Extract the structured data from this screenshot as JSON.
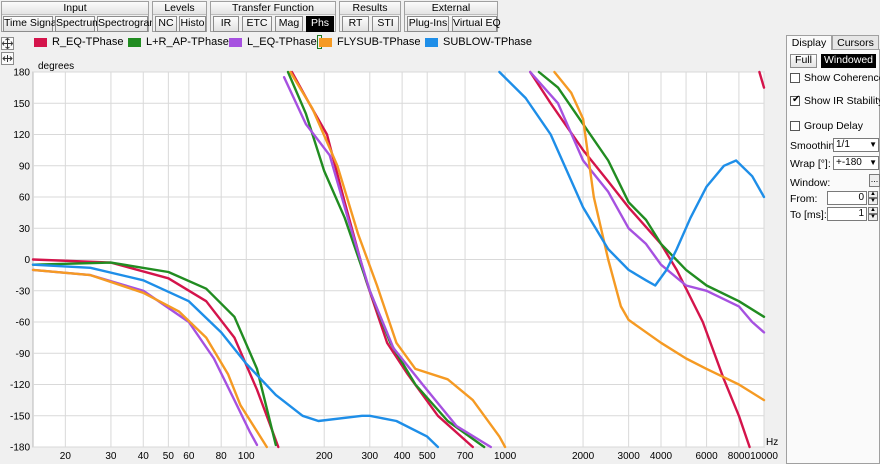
{
  "toolbar": {
    "groups": [
      {
        "title": "Input",
        "buttons": [
          "Time Signal",
          "Spectrum",
          "Spectrogram"
        ]
      },
      {
        "title": "Levels",
        "buttons": [
          "NC",
          "Histo"
        ]
      },
      {
        "title": "Transfer Function",
        "buttons": [
          "IR",
          "ETC",
          "Mag",
          "Phs"
        ]
      },
      {
        "title": "Results",
        "buttons": [
          "RT",
          "STI"
        ]
      },
      {
        "title": "External",
        "buttons": [
          "Plug-Ins",
          "Virtual EQ"
        ]
      }
    ],
    "active_button": "Phs"
  },
  "chart_data": {
    "type": "line",
    "ylabel": "degrees",
    "xlabel": "Hz",
    "x_scale": "log",
    "xlim": [
      15,
      10000
    ],
    "ylim": [
      -180,
      180
    ],
    "x_ticks": [
      20,
      30,
      40,
      50,
      60,
      80,
      100,
      200,
      300,
      400,
      500,
      700,
      1000,
      2000,
      3000,
      4000,
      5000,
      6000,
      8000,
      10000
    ],
    "x_tick_labels": [
      "20",
      "30",
      "40",
      "50",
      "60",
      "80",
      "100",
      "200",
      "300",
      "400",
      "500",
      "700",
      "1000",
      "2000",
      "3000",
      "4000",
      "6000",
      "8000",
      "10000"
    ],
    "y_ticks": [
      180,
      150,
      120,
      90,
      60,
      30,
      0,
      -30,
      -60,
      -90,
      -120,
      -150,
      -180
    ],
    "grid": true,
    "legend_position": "top",
    "series": [
      {
        "name": "R_EQ-TPhase",
        "color": "#d4144b",
        "segments": [
          [
            [
              15,
              0
            ],
            [
              30,
              -3
            ],
            [
              50,
              -18
            ],
            [
              70,
              -40
            ],
            [
              90,
              -75
            ],
            [
              110,
              -125
            ],
            [
              125,
              -162
            ],
            [
              133,
              -180
            ]
          ],
          [
            [
              150,
              180
            ],
            [
              175,
              150
            ],
            [
              205,
              120
            ],
            [
              240,
              55
            ],
            [
              290,
              -20
            ],
            [
              350,
              -80
            ],
            [
              420,
              -110
            ],
            [
              550,
              -150
            ],
            [
              750,
              -180
            ]
          ],
          [
            [
              1250,
              180
            ],
            [
              1500,
              150
            ],
            [
              2000,
              105
            ],
            [
              2500,
              75
            ],
            [
              3000,
              50
            ],
            [
              4000,
              15
            ],
            [
              4600,
              -10
            ],
            [
              5800,
              -60
            ],
            [
              7000,
              -115
            ],
            [
              8000,
              -150
            ],
            [
              8800,
              -180
            ]
          ],
          [
            [
              9600,
              180
            ],
            [
              10000,
              165
            ]
          ]
        ]
      },
      {
        "name": "L+R_AP-TPhase",
        "color": "#218c21",
        "segments": [
          [
            [
              15,
              -5
            ],
            [
              30,
              -3
            ],
            [
              50,
              -12
            ],
            [
              70,
              -28
            ],
            [
              90,
              -55
            ],
            [
              110,
              -105
            ],
            [
              122,
              -150
            ],
            [
              130,
              -178
            ]
          ],
          [
            [
              145,
              180
            ],
            [
              170,
              140
            ],
            [
              200,
              85
            ],
            [
              240,
              40
            ],
            [
              300,
              -30
            ],
            [
              360,
              -80
            ],
            [
              450,
              -120
            ],
            [
              600,
              -155
            ],
            [
              830,
              -180
            ]
          ],
          [
            [
              1350,
              180
            ],
            [
              1600,
              165
            ],
            [
              2000,
              130
            ],
            [
              2500,
              95
            ],
            [
              3000,
              55
            ],
            [
              3500,
              38
            ],
            [
              4000,
              15
            ],
            [
              5000,
              -10
            ],
            [
              6000,
              -25
            ],
            [
              8000,
              -40
            ],
            [
              10000,
              -55
            ]
          ]
        ]
      },
      {
        "name": "L_EQ-TPhase",
        "color": "#a651e0",
        "segments": [
          [
            [
              15,
              -10
            ],
            [
              25,
              -15
            ],
            [
              40,
              -30
            ],
            [
              60,
              -60
            ],
            [
              75,
              -95
            ],
            [
              90,
              -135
            ],
            [
              103,
              -165
            ],
            [
              110,
              -178
            ]
          ],
          [
            [
              140,
              175
            ],
            [
              170,
              130
            ],
            [
              210,
              100
            ],
            [
              250,
              35
            ],
            [
              300,
              -30
            ],
            [
              370,
              -85
            ],
            [
              480,
              -120
            ],
            [
              650,
              -160
            ],
            [
              880,
              -180
            ]
          ],
          [
            [
              1250,
              180
            ],
            [
              1600,
              150
            ],
            [
              2000,
              95
            ],
            [
              2500,
              65
            ],
            [
              3000,
              30
            ],
            [
              3500,
              15
            ],
            [
              4000,
              -5
            ],
            [
              5000,
              -25
            ],
            [
              6000,
              -30
            ],
            [
              8000,
              -45
            ],
            [
              9000,
              -60
            ],
            [
              10000,
              -70
            ]
          ]
        ]
      },
      {
        "name": "FLYSUB-TPhase",
        "color": "#f59a23",
        "segments": [
          [
            [
              15,
              -10
            ],
            [
              25,
              -15
            ],
            [
              40,
              -32
            ],
            [
              55,
              -50
            ],
            [
              70,
              -75
            ],
            [
              85,
              -110
            ],
            [
              95,
              -140
            ],
            [
              110,
              -165
            ],
            [
              120,
              -180
            ]
          ],
          [
            [
              148,
              180
            ],
            [
              180,
              145
            ],
            [
              225,
              90
            ],
            [
              270,
              25
            ],
            [
              320,
              -25
            ],
            [
              380,
              -80
            ],
            [
              450,
              -105
            ],
            [
              600,
              -115
            ],
            [
              750,
              -135
            ],
            [
              950,
              -170
            ],
            [
              1000,
              -180
            ]
          ],
          [
            [
              1550,
              180
            ],
            [
              1800,
              160
            ],
            [
              2000,
              135
            ],
            [
              2200,
              60
            ],
            [
              2500,
              0
            ],
            [
              2800,
              -45
            ],
            [
              3000,
              -58
            ],
            [
              4000,
              -80
            ],
            [
              5000,
              -95
            ],
            [
              6000,
              -105
            ],
            [
              8000,
              -120
            ],
            [
              10000,
              -135
            ]
          ]
        ]
      },
      {
        "name": "SUBLOW-TPhase",
        "color": "#1e8ee8",
        "segments": [
          [
            [
              15,
              -5
            ],
            [
              25,
              -8
            ],
            [
              40,
              -20
            ],
            [
              60,
              -40
            ],
            [
              80,
              -70
            ],
            [
              100,
              -100
            ],
            [
              130,
              -130
            ],
            [
              165,
              -150
            ],
            [
              190,
              -155
            ],
            [
              280,
              -150
            ],
            [
              300,
              -150
            ],
            [
              380,
              -155
            ],
            [
              500,
              -170
            ],
            [
              550,
              -180
            ]
          ],
          [
            [
              950,
              180
            ],
            [
              1200,
              155
            ],
            [
              1500,
              120
            ],
            [
              2000,
              50
            ],
            [
              2500,
              10
            ],
            [
              3000,
              -10
            ],
            [
              3500,
              -20
            ],
            [
              3800,
              -25
            ],
            [
              4200,
              -10
            ],
            [
              4600,
              10
            ],
            [
              5200,
              40
            ],
            [
              6000,
              70
            ],
            [
              7000,
              90
            ],
            [
              7800,
              95
            ],
            [
              9000,
              80
            ],
            [
              10000,
              60
            ]
          ]
        ]
      }
    ]
  },
  "chart_text": {
    "ylabel": "degrees",
    "xlabel": "Hz"
  },
  "panel": {
    "tabs": [
      "Display",
      "Cursors"
    ],
    "full_label": "Full",
    "windowed_label": "Windowed",
    "show_coherence": {
      "label": "Show Coherence",
      "checked": false
    },
    "show_ir_stability": {
      "label": "Show IR Stability",
      "checked": true
    },
    "group_delay": {
      "label": "Group Delay",
      "checked": false
    },
    "smoothing_label": "Smoothing:",
    "smoothing_value": "1/1",
    "wrap_label": "Wrap [°]:",
    "wrap_value": "+-180",
    "window_label": "Window:",
    "window_button": "...",
    "from_label": "From:",
    "from_value": "0",
    "to_label": "To [ms]:",
    "to_value": "1"
  }
}
